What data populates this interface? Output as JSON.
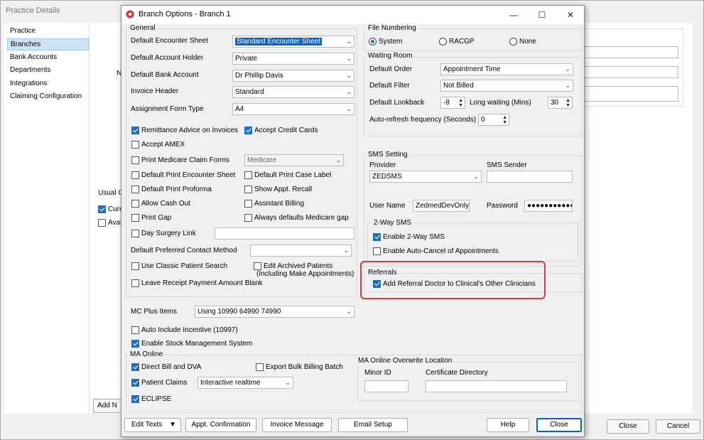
{
  "background": {
    "title": "Practice Details",
    "nav": [
      "Practice",
      "Branches",
      "Bank Accounts",
      "Departments",
      "Integrations",
      "Claiming Configuration"
    ],
    "labels": {
      "n": "N",
      "usual": "Usual C",
      "curr": "Curr",
      "avai": "Avai"
    },
    "buttons": {
      "add": "Add N",
      "close": "Close",
      "cancel": "Cancel"
    }
  },
  "dialog": {
    "title": "Branch Options - Branch 1",
    "window_controls": {
      "minimize": "—",
      "maximize": "☐",
      "close": "✕"
    },
    "general": {
      "label": "General",
      "default_encounter_sheet": {
        "label": "Default Encounter Sheet",
        "value": "Standard Encounter Sheet"
      },
      "default_account_holder": {
        "label": "Default Account Holder",
        "value": "Private"
      },
      "default_bank_account": {
        "label": "Default Bank Account",
        "value": "Dr Phillip Davis"
      },
      "invoice_header": {
        "label": "Invoice Header",
        "value": "Standard"
      },
      "assignment_form_type": {
        "label": "Assignment Form Type",
        "value": "A4"
      },
      "checks": {
        "remittance_advice": "Remittance Advice on Invoices",
        "accept_credit_cards": "Accept Credit Cards",
        "accept_amex": "Accept AMEX",
        "print_medicare_claim_forms": "Print Medicare Claim Forms",
        "medicare_value": "Medicare",
        "default_print_encounter_sheet": "Default Print Encounter Sheet",
        "default_print_case_label": "Default Print Case Label",
        "default_print_proforma": "Default Print Proforma",
        "show_appt_recall": "Show Appt. Recall",
        "allow_cash_out": "Allow Cash Out",
        "assistant_billing": "Assistant Billing",
        "print_gap": "Print Gap",
        "always_defaults_medicare_gap": "Always defaults Medicare gap",
        "day_surgery_link": "Day Surgery Link"
      },
      "default_preferred_contact_method": "Default Preferred Contact Method",
      "use_classic_patient_search": "Use Classic Patient Search",
      "edit_archived_patients_1": "Edit Archived Patients",
      "edit_archived_patients_2": "(Including Make Appointments)",
      "leave_receipt_payment_blank": "Leave Receipt Payment Amount Blank"
    },
    "mc_plus": {
      "label": "MC Plus Items",
      "value": "Using 10990 64990 74990"
    },
    "auto_include_incentive": "Auto Include Incentive (10997)",
    "enable_stock_management": "Enable Stock Management System",
    "ma_online": {
      "label": "MA Online",
      "direct_bill_dva": "Direct Bill and DVA",
      "export_bulk_billing_batch": "Export Bulk Billing Batch",
      "patient_claims": "Patient Claims",
      "patient_claims_value": "Interactive realtime",
      "eclipse": "ECLIPSE"
    },
    "ma_overwrite": {
      "label": "MA Online Overwrite Location",
      "minor_id": "Minor ID",
      "certificate_directory": "Certificate Directory"
    },
    "file_numbering": {
      "label": "File Numbering",
      "options": [
        "System",
        "RACGP",
        "None"
      ]
    },
    "waiting_room": {
      "label": "Waiting Room",
      "default_order": {
        "label": "Default Order",
        "value": "Appointment Time"
      },
      "default_filter": {
        "label": "Default Filter",
        "value": "Not Billed"
      },
      "default_lookback": {
        "label": "Default Lookback",
        "value": "-8"
      },
      "long_waiting": {
        "label": "Long waiting (Mins)",
        "value": "30"
      },
      "auto_refresh": {
        "label": "Auto-refresh frequency (Seconds)",
        "value": "0"
      }
    },
    "sms": {
      "label": "SMS Setting",
      "provider_label": "Provider",
      "provider_value": "ZEDSMS",
      "sender_label": "SMS Sender",
      "user_name_label": "User Name",
      "user_name_value": "ZedmedDevOnly'",
      "password_label": "Password",
      "password_value": "●●●●●●●●●●●",
      "two_way_label": "2-Way SMS",
      "enable_two_way": "Enable 2-Way SMS",
      "enable_auto_cancel": "Enable Auto-Cancel of Appointments"
    },
    "referrals": {
      "label": "Referrals",
      "add_referral_doctor": "Add Referral Doctor to Clinical's Other Clinicians"
    },
    "footer": {
      "edit_texts": "Edit Texts",
      "appt_confirmation": "Appt. Confirmation",
      "invoice_message": "Invoice Message",
      "email_setup": "Email Setup",
      "help": "Help",
      "close": "Close"
    }
  }
}
